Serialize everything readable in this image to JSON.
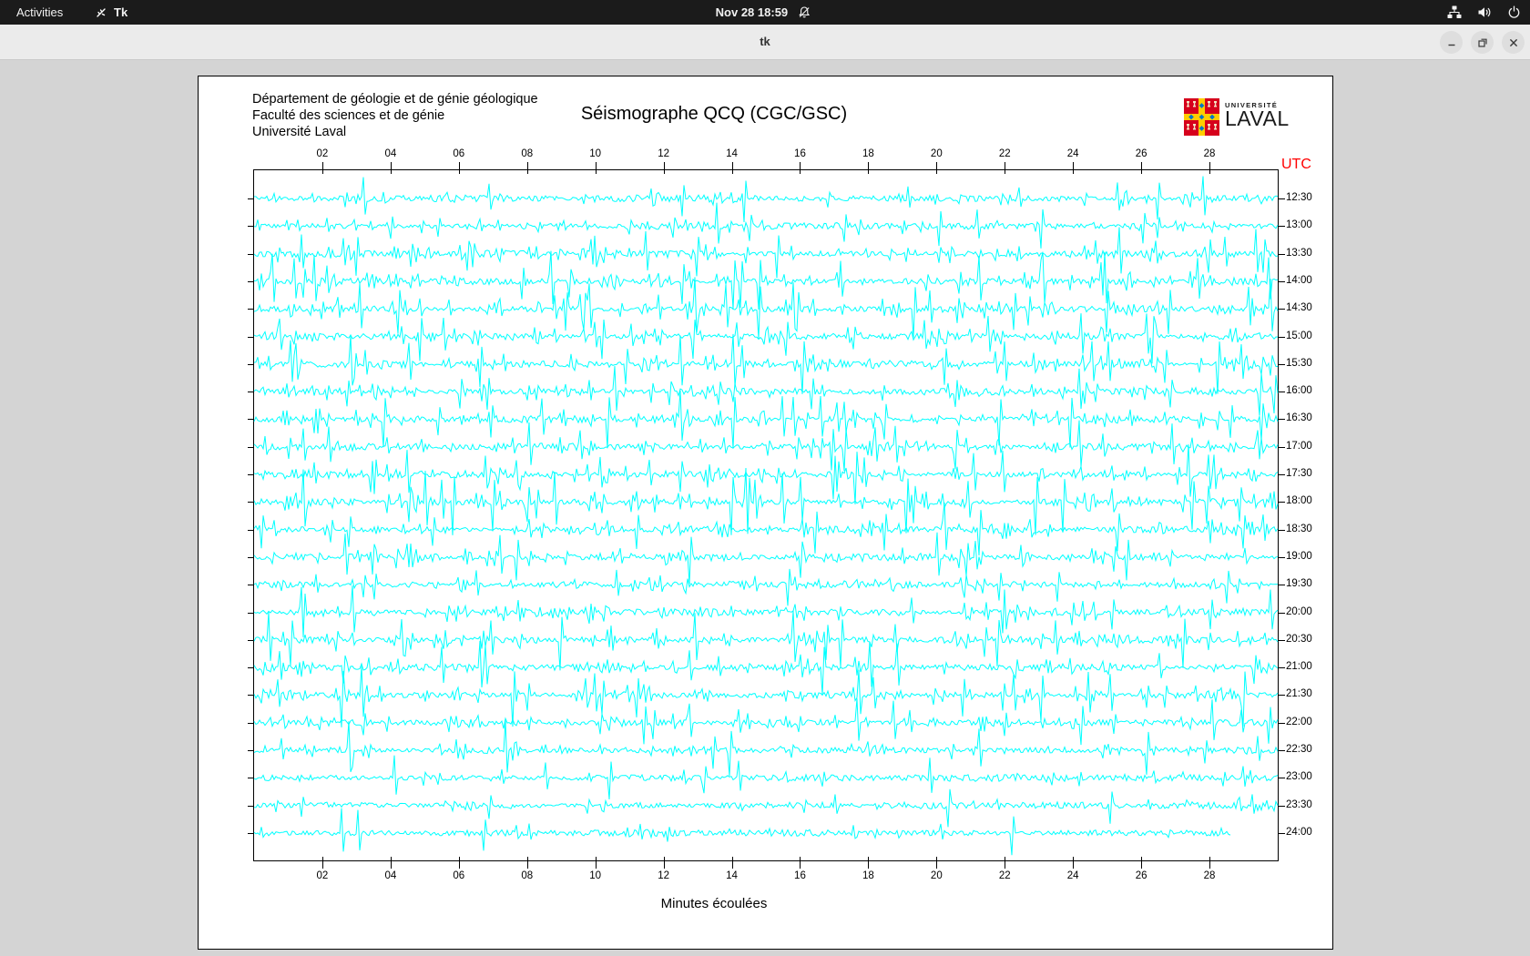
{
  "top_bar": {
    "activities_label": "Activities",
    "app_name": "Tk",
    "clock": "Nov 28 18:59",
    "status_icons": [
      "notifications-off-icon",
      "network-icon",
      "volume-icon",
      "power-icon"
    ]
  },
  "title_bar": {
    "title": "tk",
    "buttons": [
      "minimize",
      "restore",
      "close"
    ]
  },
  "seismograph": {
    "header_lines": [
      "Département de géologie et de génie géologique",
      "Faculté des sciences et de génie",
      "Université Laval"
    ],
    "title": "Séismographe QCQ (CGC/GSC)",
    "logo": {
      "line1": "UNIVERSITÉ",
      "line2": "LAVAL"
    },
    "utc_label": "UTC",
    "xlabel": "Minutes écoulées",
    "x_ticks": [
      "02",
      "04",
      "06",
      "08",
      "10",
      "12",
      "14",
      "16",
      "18",
      "20",
      "22",
      "24",
      "26",
      "28"
    ],
    "x_range_minutes": [
      0,
      30
    ],
    "trace_color": "#00ffff",
    "utc_color": "#ff0000",
    "rows": [
      {
        "time": "12:30",
        "seed": 11,
        "spikes": 10,
        "amp": 28,
        "end": 1
      },
      {
        "time": "13:00",
        "seed": 12,
        "spikes": 12,
        "amp": 26,
        "end": 1
      },
      {
        "time": "13:30",
        "seed": 13,
        "spikes": 18,
        "amp": 30,
        "end": 1
      },
      {
        "time": "14:00",
        "seed": 14,
        "spikes": 22,
        "amp": 34,
        "end": 1
      },
      {
        "time": "14:30",
        "seed": 15,
        "spikes": 24,
        "amp": 36,
        "end": 1
      },
      {
        "time": "15:00",
        "seed": 16,
        "spikes": 18,
        "amp": 30,
        "end": 1
      },
      {
        "time": "15:30",
        "seed": 17,
        "spikes": 22,
        "amp": 34,
        "end": 1
      },
      {
        "time": "16:00",
        "seed": 18,
        "spikes": 18,
        "amp": 28,
        "end": 1
      },
      {
        "time": "16:30",
        "seed": 19,
        "spikes": 20,
        "amp": 34,
        "end": 1
      },
      {
        "time": "17:00",
        "seed": 20,
        "spikes": 18,
        "amp": 30,
        "end": 1
      },
      {
        "time": "17:30",
        "seed": 21,
        "spikes": 20,
        "amp": 34,
        "end": 1
      },
      {
        "time": "18:00",
        "seed": 22,
        "spikes": 24,
        "amp": 38,
        "end": 1
      },
      {
        "time": "18:30",
        "seed": 23,
        "spikes": 18,
        "amp": 30,
        "end": 1
      },
      {
        "time": "19:00",
        "seed": 24,
        "spikes": 16,
        "amp": 30,
        "end": 1
      },
      {
        "time": "19:30",
        "seed": 25,
        "spikes": 12,
        "amp": 26,
        "end": 1
      },
      {
        "time": "20:00",
        "seed": 26,
        "spikes": 16,
        "amp": 30,
        "end": 1
      },
      {
        "time": "20:30",
        "seed": 27,
        "spikes": 20,
        "amp": 34,
        "end": 1
      },
      {
        "time": "21:00",
        "seed": 28,
        "spikes": 16,
        "amp": 30,
        "end": 1
      },
      {
        "time": "21:30",
        "seed": 29,
        "spikes": 20,
        "amp": 36,
        "end": 1
      },
      {
        "time": "22:00",
        "seed": 30,
        "spikes": 16,
        "amp": 30,
        "end": 1
      },
      {
        "time": "22:30",
        "seed": 31,
        "spikes": 12,
        "amp": 34,
        "end": 1
      },
      {
        "time": "23:00",
        "seed": 32,
        "spikes": 7,
        "amp": 28,
        "end": 1
      },
      {
        "time": "23:30",
        "seed": 33,
        "spikes": 6,
        "amp": 24,
        "end": 1
      },
      {
        "time": "24:00",
        "seed": 34,
        "spikes": 4,
        "amp": 30,
        "end": 0.955
      }
    ]
  }
}
